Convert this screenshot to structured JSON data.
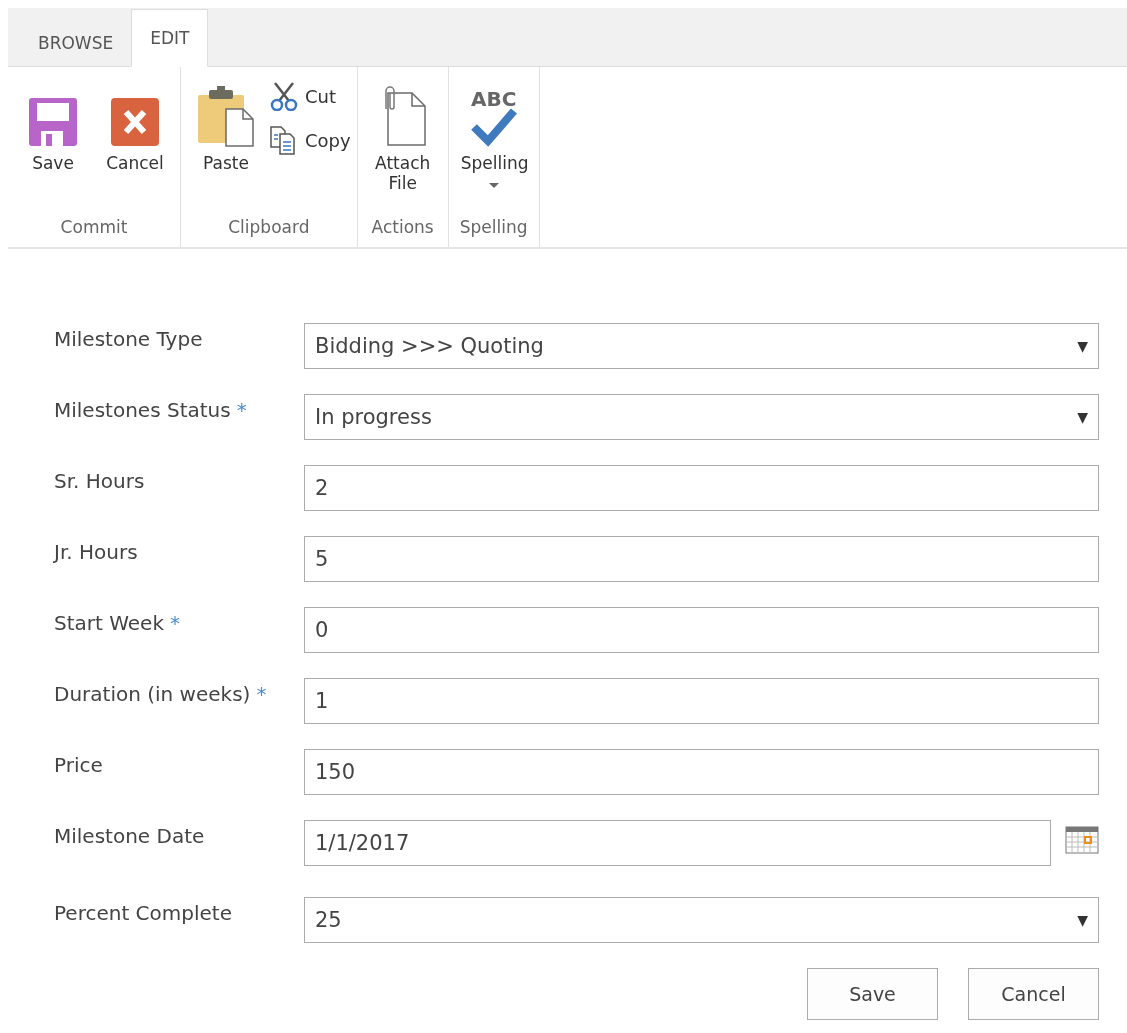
{
  "tabs": [
    {
      "label": "BROWSE",
      "selected": false
    },
    {
      "label": "EDIT",
      "selected": true
    }
  ],
  "ribbon_groups": [
    {
      "label": "Commit",
      "commands": [
        {
          "kind": "large",
          "label": "Save"
        },
        {
          "kind": "large",
          "label": "Cancel"
        }
      ]
    },
    {
      "label": "Clipboard",
      "commands": [
        {
          "kind": "large",
          "label": "Paste"
        },
        {
          "kind": "small",
          "label": "Cut"
        },
        {
          "kind": "small",
          "label": "Copy"
        }
      ]
    },
    {
      "label": "Actions",
      "commands": [
        {
          "kind": "large",
          "label": "Attach File"
        }
      ]
    },
    {
      "label": "Spelling",
      "commands": [
        {
          "kind": "large",
          "icon_text": "ABC",
          "label": "Spelling",
          "dropdown": true
        }
      ]
    }
  ],
  "fields": [
    {
      "label": "Milestone Type",
      "kind": "select",
      "value": "Bidding >>> Quoting",
      "caret": "▼"
    },
    {
      "label": "Milestones Status",
      "required_mark": "*",
      "kind": "select",
      "value": "In progress",
      "caret": "▼"
    },
    {
      "label": "Sr. Hours",
      "kind": "text",
      "value": "2"
    },
    {
      "label": "Jr. Hours",
      "kind": "text",
      "value": "5"
    },
    {
      "label": "Start Week",
      "required_mark": "*",
      "kind": "text",
      "value": "0"
    },
    {
      "label": "Duration (in weeks)",
      "required_mark": "*",
      "kind": "text",
      "value": "1"
    },
    {
      "label": "Price",
      "kind": "text",
      "value": "150"
    },
    {
      "label": "Milestone Date",
      "kind": "date",
      "value": "1/1/2017"
    },
    {
      "label": "Percent Complete",
      "kind": "select",
      "value": "25",
      "caret": "▼"
    }
  ],
  "buttons": [
    "Save",
    "Cancel"
  ]
}
